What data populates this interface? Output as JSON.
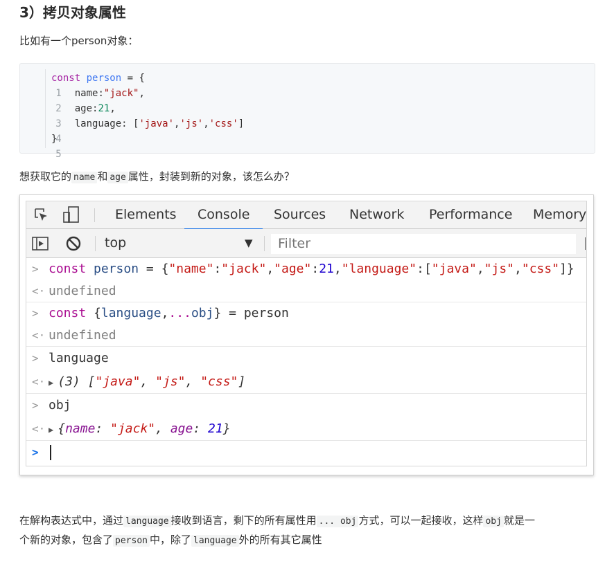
{
  "heading": "3）拷贝对象属性",
  "intro": "比如有一个person对象：",
  "code_block": {
    "lines": [
      {
        "num": "1",
        "kw": "const",
        "sp1": " ",
        "var": "person",
        "rest": " = {"
      },
      {
        "num": "2",
        "indent": "    ",
        "key": "name",
        "colon": ":",
        "str": "\"jack\"",
        "tail": ","
      },
      {
        "num": "3",
        "indent": "    ",
        "key": "age",
        "colon": ":",
        "numval": "21",
        "tail": ","
      },
      {
        "num": "4",
        "indent": "    ",
        "key": "language",
        "colon": ": [",
        "s1": "'java'",
        "c1": ",",
        "s2": "'js'",
        "c2": ",",
        "s3": "'css'",
        "tail": "]"
      },
      {
        "num": "5",
        "close": "}"
      }
    ]
  },
  "question": {
    "prefix": "想获取它的",
    "code1": "name",
    "mid": "和",
    "code2": "age",
    "suffix": "属性，封装到新的对象，该怎么办？"
  },
  "devtools": {
    "tabs": [
      "Elements",
      "Console",
      "Sources",
      "Network",
      "Performance",
      "Memory"
    ],
    "active_tab": "Console",
    "context": "top",
    "filter_placeholder": "Filter",
    "icons": [
      "inspect-icon",
      "device-toggle-icon",
      "sidebar-toggle-icon",
      "clear-console-icon",
      "dropdown-arrow-icon"
    ],
    "console": {
      "r1": {
        "kw": "const",
        "var": "person",
        "eq": " = ",
        "obj_open": "{",
        "k1": "\"name\"",
        "col1": ":",
        "v1": "\"jack\"",
        "comma1": ",",
        "k2": "\"age\"",
        "col2": ":",
        "v2": "21",
        "comma2": ",",
        "k3": "\"language\"",
        "col3": ":[",
        "a1": "\"java\"",
        "ac1": ",",
        "a2": "\"js\"",
        "ac2": ",",
        "a3": "\"css\"",
        "obj_close": "]}"
      },
      "r2": "undefined",
      "r3": {
        "kw": "const",
        "brace_open": " {",
        "v1": "language",
        "comma": ",",
        "spread": "...",
        "v2": "obj",
        "brace_close": "}",
        "eq": " = ",
        "rhs": "person"
      },
      "r4": "undefined",
      "r5": "language",
      "r6": {
        "count": "(3)",
        "open": " [",
        "a1": "\"java\"",
        "sep1": ", ",
        "a2": "\"js\"",
        "sep2": ", ",
        "a3": "\"css\"",
        "close": "]"
      },
      "r7": "obj",
      "r8": {
        "open": "{",
        "k1": "name",
        "col1": ": ",
        "v1": "\"jack\"",
        "sep": ", ",
        "k2": "age",
        "col2": ": ",
        "v2": "21",
        "close": "}"
      },
      "prompt_input": ""
    }
  },
  "summary": {
    "p1": "在解构表达式中，通过",
    "c1": "language",
    "p2": "接收到语言，剩下的所有属性用",
    "c2": "... obj",
    "p3": "方式，可以一起接收，这样",
    "c3": "obj",
    "p4": "就是一",
    "p5": "个新的对象，包含了",
    "c4": "person",
    "p6": "中，除了",
    "c5": "language",
    "p7": "外的所有其它属性"
  },
  "colors": {
    "tab_active_underline": "#1a73e8",
    "keyword": "#aa0d91",
    "string": "#c41a16",
    "number": "#1c00cf"
  }
}
